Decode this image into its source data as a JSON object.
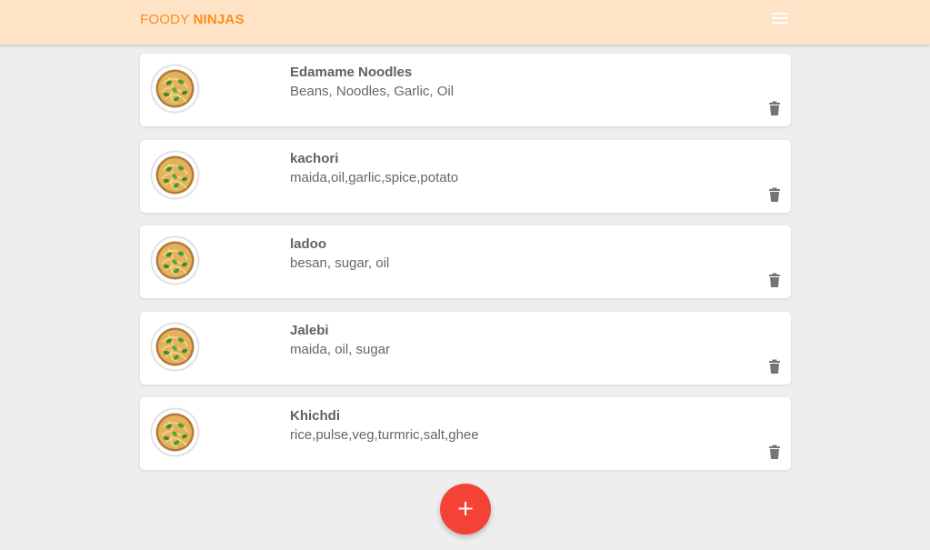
{
  "app": {
    "brand_part1": "FOODY",
    "brand_part2": "NINJAS",
    "menu_icon": "hamburger-menu-icon"
  },
  "colors": {
    "navbar_bg": "#ffe3c6",
    "brand": "#ff8c1a",
    "page_bg": "#eeeeee",
    "fab": "#f44336",
    "delete_icon": "#757575"
  },
  "recipes": [
    {
      "title": "Edamame Noodles",
      "ingredients": "Beans, Noodles, Garlic, Oil",
      "image_icon": "noodle-bowl-icon",
      "delete_icon": "trash-icon"
    },
    {
      "title": "kachori",
      "ingredients": "maida,oil,garlic,spice,potato",
      "image_icon": "noodle-bowl-icon",
      "delete_icon": "trash-icon"
    },
    {
      "title": "ladoo",
      "ingredients": "besan, sugar, oil",
      "image_icon": "noodle-bowl-icon",
      "delete_icon": "trash-icon"
    },
    {
      "title": "Jalebi",
      "ingredients": "maida, oil, sugar",
      "image_icon": "noodle-bowl-icon",
      "delete_icon": "trash-icon"
    },
    {
      "title": "Khichdi",
      "ingredients": "rice,pulse,veg,turmric,salt,ghee",
      "image_icon": "noodle-bowl-icon",
      "delete_icon": "trash-icon"
    }
  ],
  "fab": {
    "label": "+",
    "icon": "add-icon"
  }
}
